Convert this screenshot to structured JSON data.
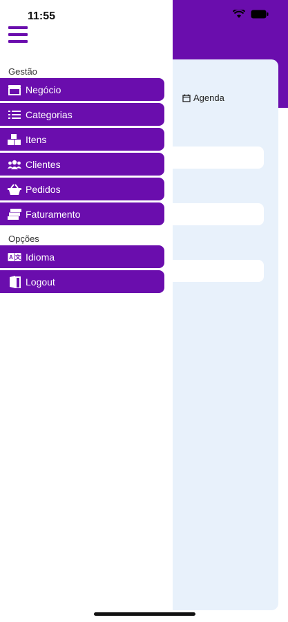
{
  "status_bar": {
    "time": "11:55"
  },
  "header": {
    "agenda_label": "Agenda"
  },
  "drawer": {
    "sections": [
      {
        "title": "Gestão",
        "items": [
          {
            "label": "Negócio",
            "icon": "store-icon"
          },
          {
            "label": "Categorias",
            "icon": "list-icon"
          },
          {
            "label": "Itens",
            "icon": "boxes-icon"
          },
          {
            "label": "Clientes",
            "icon": "users-icon"
          },
          {
            "label": "Pedidos",
            "icon": "basket-icon"
          },
          {
            "label": "Faturamento",
            "icon": "money-icon"
          }
        ]
      },
      {
        "title": "Opções",
        "items": [
          {
            "label": "Idioma",
            "icon": "language-icon"
          },
          {
            "label": "Logout",
            "icon": "door-icon"
          }
        ]
      }
    ]
  },
  "colors": {
    "brand": "#6a0dad",
    "panel": "#e8f1fb"
  }
}
